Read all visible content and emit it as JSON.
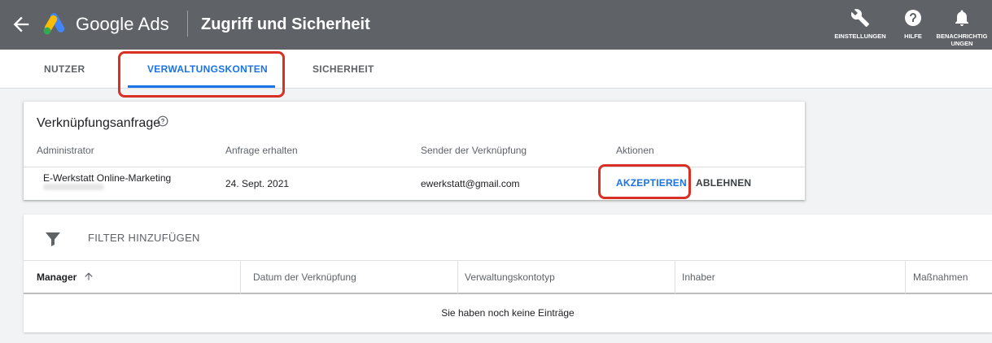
{
  "header": {
    "brand": "Google Ads",
    "page_title": "Zugriff und Sicherheit",
    "buttons": {
      "settings": "EINSTELLUNGEN",
      "help": "HILFE",
      "notifications_line1": "BENACHRICHTIG",
      "notifications_line2": "UNGEN"
    }
  },
  "tabs": [
    {
      "label": "NUTZER",
      "active": false
    },
    {
      "label": "VERWALTUNGSKONTEN",
      "active": true
    },
    {
      "label": "SICHERHEIT",
      "active": false
    }
  ],
  "link_request": {
    "title": "Verknüpfungsanfrage",
    "columns": [
      "Administrator",
      "Anfrage erhalten",
      "Sender der Verknüpfung",
      "Aktionen"
    ],
    "row": {
      "administrator": "E-Werkstatt Online-Marketing",
      "received": "24. Sept. 2021",
      "sender": "ewerkstatt@gmail.com",
      "accept": "AKZEPTIEREN",
      "decline": "ABLEHNEN"
    }
  },
  "managers_table": {
    "filter_label": "FILTER HINZUFÜGEN",
    "columns": [
      "Manager",
      "Datum der Verknüpfung",
      "Verwaltungskontotyp",
      "Inhaber",
      "Maßnahmen"
    ],
    "empty_message": "Sie haben noch keine Einträge"
  },
  "colors": {
    "header_bg": "#5f6368",
    "accent": "#1a73e8",
    "highlight": "#d93025"
  }
}
